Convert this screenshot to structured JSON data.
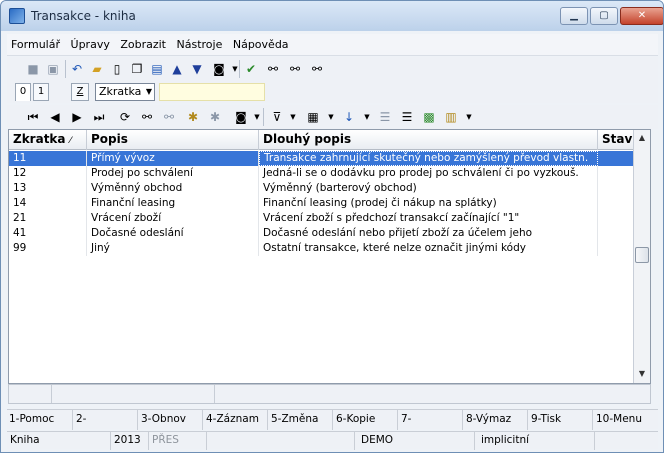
{
  "window": {
    "title": "Transakce - kniha",
    "minimize_icon": "minimize-icon",
    "maximize_icon": "maximize-icon",
    "close_icon": "close-icon"
  },
  "menu": [
    "Formulář",
    "Úpravy",
    "Zobrazit",
    "Nástroje",
    "Nápověda"
  ],
  "tabs": {
    "tab0": "0",
    "tab1": "1",
    "z_label": "Z",
    "sort_value": "Zkratka",
    "search_value": ""
  },
  "grid": {
    "columns": [
      "Zkratka",
      "Popis",
      "Dlouhý popis",
      "Stav"
    ],
    "sort_indicator": "⁄",
    "rows": [
      {
        "code": "11",
        "name": "Přímý vývoz",
        "desc": "Transakce zahrnující skutečný nebo zamýšlený převod vlastn."
      },
      {
        "code": "12",
        "name": "Prodej po schválení",
        "desc": "Jedná-li se o dodávku pro prodej po schválení či po vyzkouš."
      },
      {
        "code": "13",
        "name": "Výměnný obchod",
        "desc": "Výměnný (barterový obchod)"
      },
      {
        "code": "14",
        "name": "Finanční leasing",
        "desc": "Finanční leasing  (prodej či nákup na splátky)"
      },
      {
        "code": "21",
        "name": "Vrácení zboží",
        "desc": "Vrácení zboží s předchozí transakcí začínající \"1\""
      },
      {
        "code": "41",
        "name": "Dočasné odeslání",
        "desc": "Dočasné odeslání nebo přijetí zboží za účelem jeho"
      },
      {
        "code": "99",
        "name": "Jiný",
        "desc": "Ostatní transakce, které nelze označit jinými kódy"
      }
    ]
  },
  "function_keys": [
    "1-Pomoc",
    "2-",
    "3-Obnov",
    "4-Záznam",
    "5-Změna",
    "6-Kopie",
    "7-",
    "8-Výmaz",
    "9-Tisk",
    "10-Menu"
  ],
  "status": {
    "book": "Kniha",
    "year": "2013",
    "mode": "PŘES",
    "db": "DEMO",
    "default": "implicitní"
  },
  "colors": {
    "selection": "#3875d7",
    "title_bg": "#bcd1ea"
  }
}
